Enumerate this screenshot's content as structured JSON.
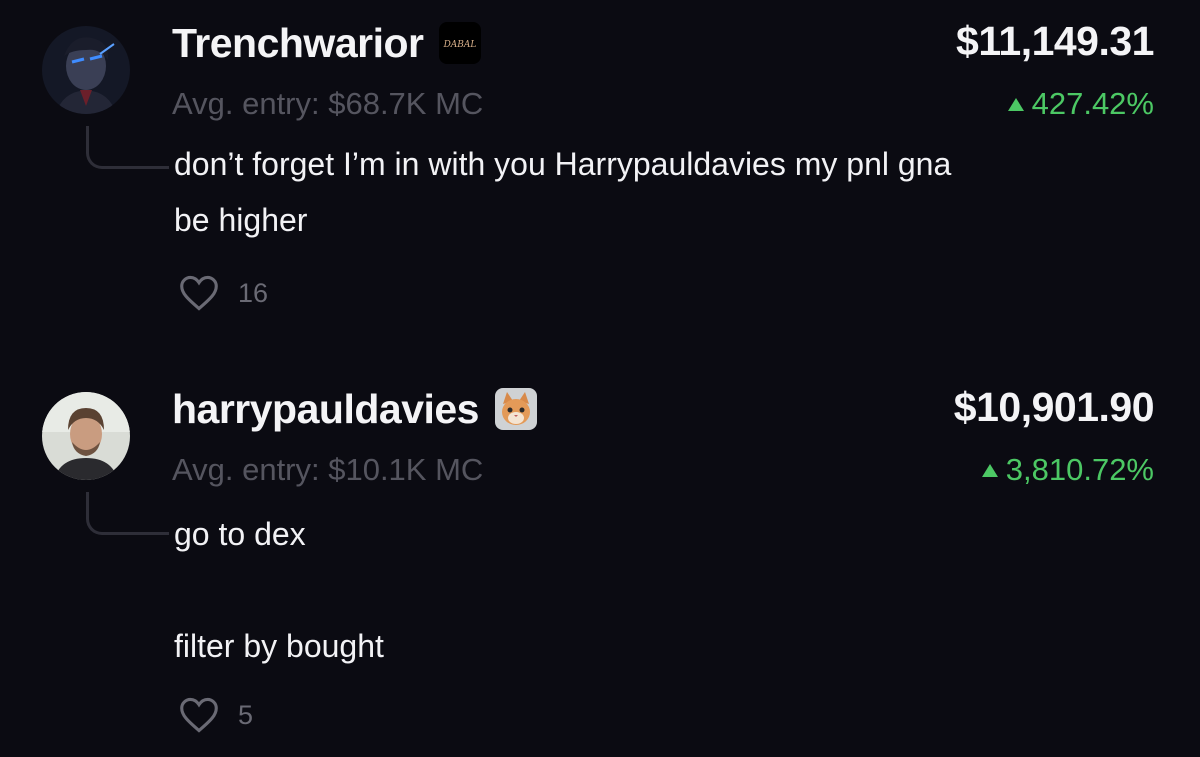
{
  "comments": [
    {
      "username": "Trenchwarior",
      "badge_icon": "dabal-token-logo-icon",
      "badge_text": "DABAL",
      "amount": "$11,149.31",
      "avg_entry": "Avg. entry: $68.7K MC",
      "pnl_percent": "427.42%",
      "pnl_direction": "up",
      "message": "don’t forget I’m in with you Harrypauldavies my pnl gna\nbe higher",
      "likes": "16"
    },
    {
      "username": "harrypauldavies",
      "badge_icon": "kitten-token-logo-icon",
      "amount": "$10,901.90",
      "avg_entry": "Avg. entry: $10.1K MC",
      "pnl_percent": "3,810.72%",
      "pnl_direction": "up",
      "message": "go to dex\n\nfilter by bought",
      "likes": "5"
    }
  ],
  "colors": {
    "background": "#0b0b12",
    "text_primary": "#f2f2f5",
    "text_muted": "#55555f",
    "positive": "#4cc864",
    "thread_line": "#2e2e38"
  }
}
